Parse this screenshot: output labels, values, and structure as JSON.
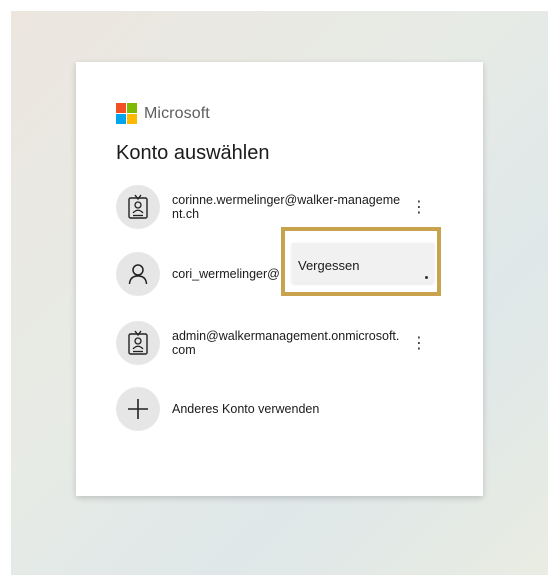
{
  "brand": {
    "name": "Microsoft",
    "logo_colors": [
      "#f25022",
      "#7fba00",
      "#00a4ef",
      "#ffb900"
    ]
  },
  "title": "Konto auswählen",
  "accounts": [
    {
      "email": "corinne.wermelinger@walker-management.ch",
      "icon": "badge-icon",
      "more": "⋮"
    },
    {
      "email": "cori_wermelinger@",
      "icon": "person-icon",
      "more": "⋮"
    },
    {
      "email": "admin@walkermanagement.onmicrosoft.com",
      "icon": "badge-icon",
      "more": "⋮"
    }
  ],
  "add_account": {
    "label": "Anderes Konto verwenden",
    "icon": "plus-icon"
  },
  "context_menu": {
    "item": "Vergessen"
  },
  "colors": {
    "highlight": "#c9a24e",
    "avatar_bg": "#e6e6e6"
  }
}
